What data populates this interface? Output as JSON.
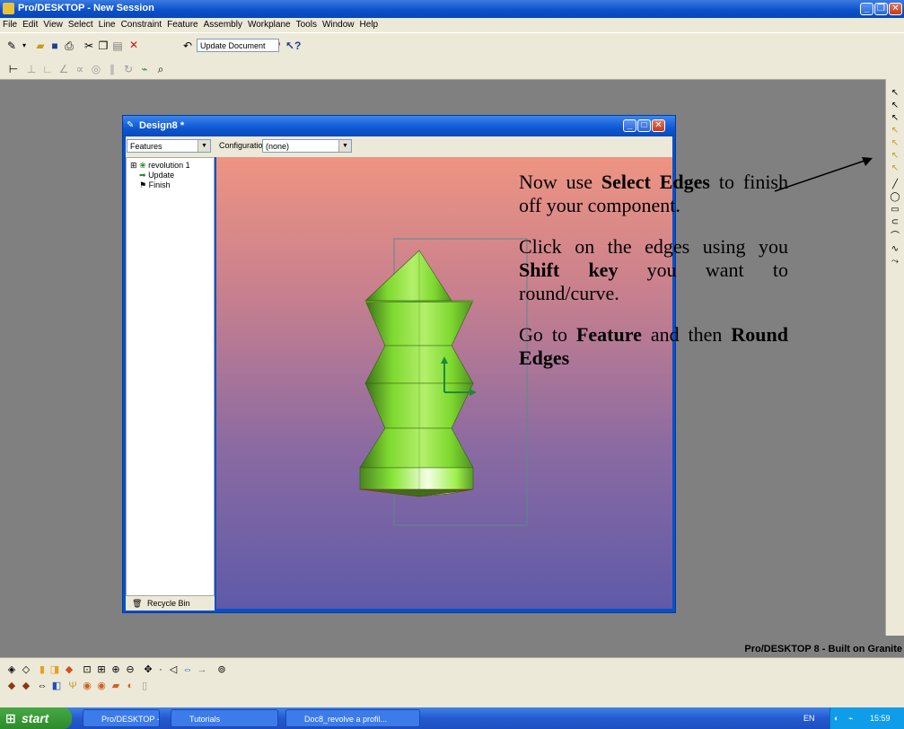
{
  "app": {
    "title": "Pro/DESKTOP - New Session"
  },
  "menu": [
    "File",
    "Edit",
    "View",
    "Select",
    "Line",
    "Constraint",
    "Feature",
    "Assembly",
    "Workplane",
    "Tools",
    "Window",
    "Help"
  ],
  "toolbar": {
    "undo_label": "Update Document"
  },
  "design_window": {
    "title": "Design8 *",
    "browser_select": "Features",
    "configuration_label": "Configuration:",
    "configuration_value": "(none)",
    "tree": [
      "revolution 1",
      "Update",
      "Finish"
    ],
    "recycle_bin": "Recycle Bin"
  },
  "instructions": {
    "p1_pre": "Now use ",
    "p1_bold": "Select Edges",
    "p1_post": " to finish off your component.",
    "p2_pre": "Click on the edges using you ",
    "p2_bold": "Shift key",
    "p2_post": " you want to round/curve.",
    "p3_pre": "Go to ",
    "p3_bold1": "Feature",
    "p3_mid": " and then ",
    "p3_bold2": "Round Edges"
  },
  "status": {
    "brand": "Pro/DESKTOP 8 - Built on Granite"
  },
  "taskbar": {
    "start": "start",
    "tasks": [
      "Pro/DESKTOP - New ...",
      "Tutorials",
      "Doc8_revolve a profil..."
    ],
    "tray_lang": "EN",
    "clock": "15:59"
  },
  "colors": {
    "title_blue": "#0a4fc9",
    "shape_green": "#7ed82f",
    "viewport_top": "#ee9482",
    "viewport_bottom": "#5f5aa8"
  }
}
